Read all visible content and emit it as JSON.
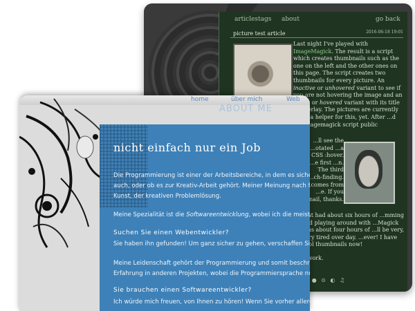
{
  "back": {
    "nav": [
      "articles",
      "tags",
      "about"
    ],
    "go_back": "go back",
    "post_title": "picture test article",
    "date": "2016-06-18 19:01",
    "para1_parts": [
      {
        "t": "Last night I've played with "
      },
      {
        "t": "ImageMagick",
        "link": true
      },
      {
        "t": ". The result is a script which creates thumbnails such as the one on the left and the other ones on this page. The script creates two thumbnails for every picture. An "
      },
      {
        "t": "inactive",
        "em": true
      },
      {
        "t": " or "
      },
      {
        "t": "unhovered",
        "em": true
      },
      {
        "t": " variant to see if you are not hovering the image and an "
      },
      {
        "t": "active",
        "em": true
      },
      {
        "t": " or "
      },
      {
        "t": "hovered",
        "em": true
      },
      {
        "t": " variant with its title as overlay. The pictures are currently ...rite a helper for this, yet. After ...d my imagemagick script public"
      }
    ],
    "para2": "...ll see the ...otated ...a CSS :hover. ...e first ...n. The third ...ch-finding. ...comes from ...e. If you ...nail, thanks.",
    "para3": "...ht had about six hours of ...mming and playing around with ...Magick plus about four hours of ...ll be very, very tired over day. ...ever! I have cool thumbnails now!",
    "para4": "...work.",
    "icons_text": "☼ ● ⊙ ◐ ♫"
  },
  "front": {
    "nav": [
      "home",
      "über mich",
      "Web"
    ],
    "about_label": "ABOUT ME",
    "heading": "nicht einfach nur ein Job",
    "p1a": "Die Programmierung ist einer der Arbeitsbereiche, in dem es sicher ...",
    "p1b": "auch, oder ob es zur Kreativ-Arbeit gehört. Meiner Meinung nach fä...ere",
    "p1c": "Kunst, der kreativen Problemlösung.",
    "p2_pre": "Meine Spezialität ist die ",
    "p2_em": "Softwareentwicklung",
    "p2_post": ", wobei ich die meiste...",
    "q1": "Suchen Sie einen Webentwickler?",
    "p3": "Sie haben ihn gefunden! Um ganz sicher zu gehen, verschaffen Sie sic...",
    "p4a": "Meine Leidenschaft gehört der Programmierung und somit beschränk...",
    "p4b": "Erfahrung in anderen Projekten, wobei die Programmiersprache nur...",
    "q2": "Sie brauchen einen Softwareentwickler?",
    "p5": "Ich würde mich freuen, von Ihnen zu hören! Wenn Sie vorher allerdi..."
  }
}
